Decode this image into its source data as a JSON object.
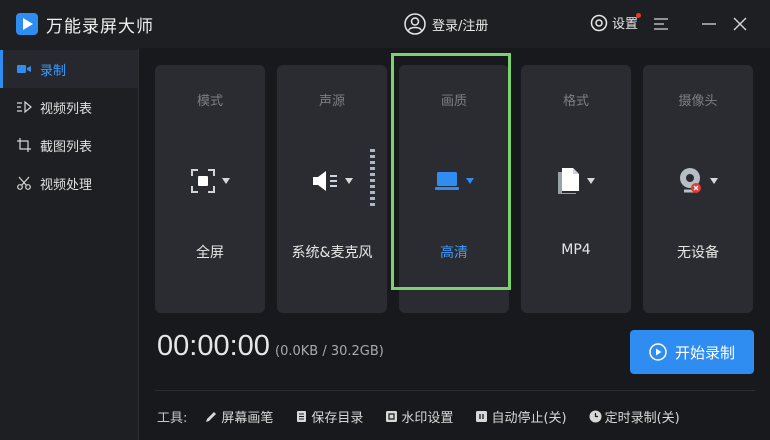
{
  "app": {
    "title": "万能录屏大师"
  },
  "header": {
    "login_label": "登录/注册",
    "settings_label": "设置"
  },
  "sidebar": {
    "items": [
      {
        "label": "录制",
        "active": true
      },
      {
        "label": "视频列表",
        "active": false
      },
      {
        "label": "截图列表",
        "active": false
      },
      {
        "label": "视频处理",
        "active": false
      }
    ]
  },
  "cards": [
    {
      "label": "模式",
      "value": "全屏",
      "icon": "fullscreen-icon"
    },
    {
      "label": "声源",
      "value": "系统&麦克风",
      "icon": "speaker-icon"
    },
    {
      "label": "画质",
      "value": "高清",
      "icon": "monitor-icon",
      "selected": true
    },
    {
      "label": "格式",
      "value": "MP4",
      "icon": "file-icon"
    },
    {
      "label": "摄像头",
      "value": "无设备",
      "icon": "camera-icon"
    }
  ],
  "status": {
    "timer": "00:00:00",
    "size": "(0.0KB / 30.2GB)"
  },
  "start_button": {
    "label": "开始录制"
  },
  "tools": {
    "label": "工具:",
    "items": [
      {
        "label": "屏幕画笔",
        "icon": "pen-icon"
      },
      {
        "label": "保存目录",
        "icon": "document-icon"
      },
      {
        "label": "水印设置",
        "icon": "watermark-icon"
      },
      {
        "label": "自动停止(关)",
        "icon": "pause-icon"
      },
      {
        "label": "定时录制(关)",
        "icon": "clock-icon"
      }
    ]
  },
  "colors": {
    "accent": "#2f8cf0",
    "highlight_border": "#7cd36e",
    "background": "#18191c",
    "card": "#2b2c31"
  }
}
